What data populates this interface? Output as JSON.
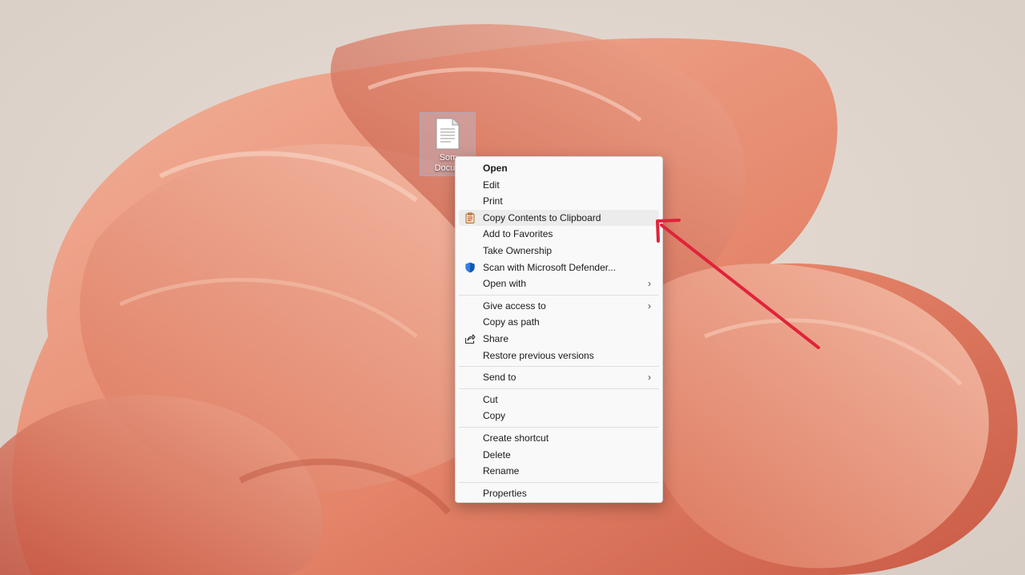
{
  "desktop": {
    "icon_label": "Som\nDocum",
    "icon_type": "text-document-icon"
  },
  "menu": {
    "items": [
      {
        "label": "Open"
      },
      {
        "label": "Edit"
      },
      {
        "label": "Print"
      },
      {
        "label": "Copy Contents to Clipboard",
        "icon": "clipboard-icon"
      },
      {
        "label": "Add to Favorites"
      },
      {
        "label": "Take Ownership"
      },
      {
        "label": "Scan with Microsoft Defender...",
        "icon": "defender-shield-icon"
      },
      {
        "label": "Open with",
        "submenu": true
      },
      {
        "label": "Give access to",
        "submenu": true
      },
      {
        "label": "Copy as path"
      },
      {
        "label": "Share",
        "icon": "share-icon"
      },
      {
        "label": "Restore previous versions"
      },
      {
        "label": "Send to",
        "submenu": true
      },
      {
        "label": "Cut"
      },
      {
        "label": "Copy"
      },
      {
        "label": "Create shortcut"
      },
      {
        "label": "Delete"
      },
      {
        "label": "Rename"
      },
      {
        "label": "Properties"
      }
    ],
    "chevron": "›"
  },
  "colors": {
    "annotation_arrow": "#e0233a",
    "wallpaper_base": "#ddd3cb",
    "wallpaper_accent": "#e98b72"
  }
}
